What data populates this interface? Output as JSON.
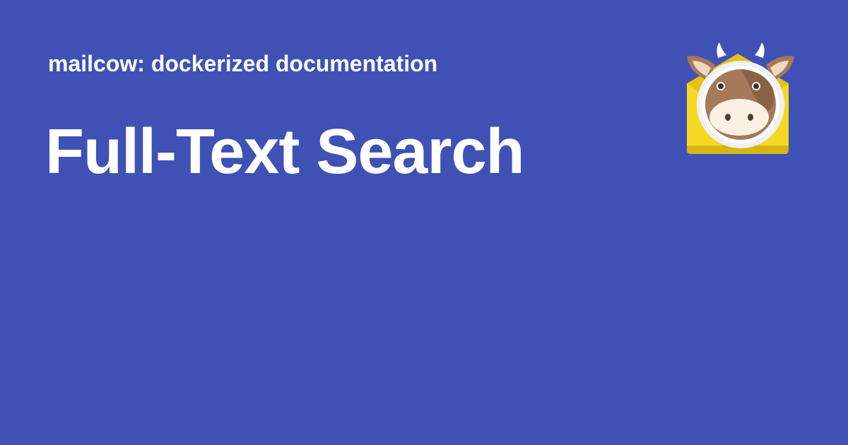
{
  "social_card": {
    "site_name": "mailcow: dockerized documentation",
    "page_title": "Full-Text Search",
    "background_color": "#3f51b5",
    "text_color": "#ffffff",
    "logo": {
      "icon": "mailcow-logo-icon",
      "envelope_color": "#f5d823",
      "face_color": "#a5795a",
      "snout_color": "#fbf0e4"
    }
  }
}
